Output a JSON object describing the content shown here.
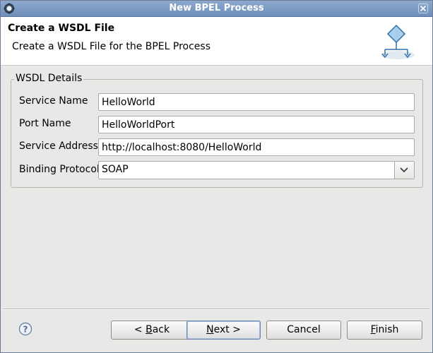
{
  "window": {
    "title": "New BPEL Process",
    "app_icon": "eclipse-gear-icon",
    "close_icon": "close-icon"
  },
  "header": {
    "title": "Create a WSDL File",
    "description": "Create a WSDL File for the BPEL Process",
    "banner_icon": "bpel-process-diagram-icon"
  },
  "group": {
    "legend": "WSDL Details",
    "fields": {
      "service_name": {
        "label": "Service Name",
        "value": "HelloWorld"
      },
      "port_name": {
        "label": "Port Name",
        "value": "HelloWorldPort"
      },
      "service_address": {
        "label": "Service Address",
        "value": "http://localhost:8080/HelloWorld"
      },
      "binding_protocol": {
        "label": "Binding Protocol",
        "value": "SOAP"
      }
    }
  },
  "footer": {
    "help_icon": "help-icon",
    "back": {
      "lead": "< ",
      "mnemonic": "B",
      "rest": "ack"
    },
    "next": {
      "mnemonic": "N",
      "rest": "ext >"
    },
    "cancel": {
      "label": "Cancel"
    },
    "finish": {
      "mnemonic": "F",
      "rest": "inish"
    }
  }
}
